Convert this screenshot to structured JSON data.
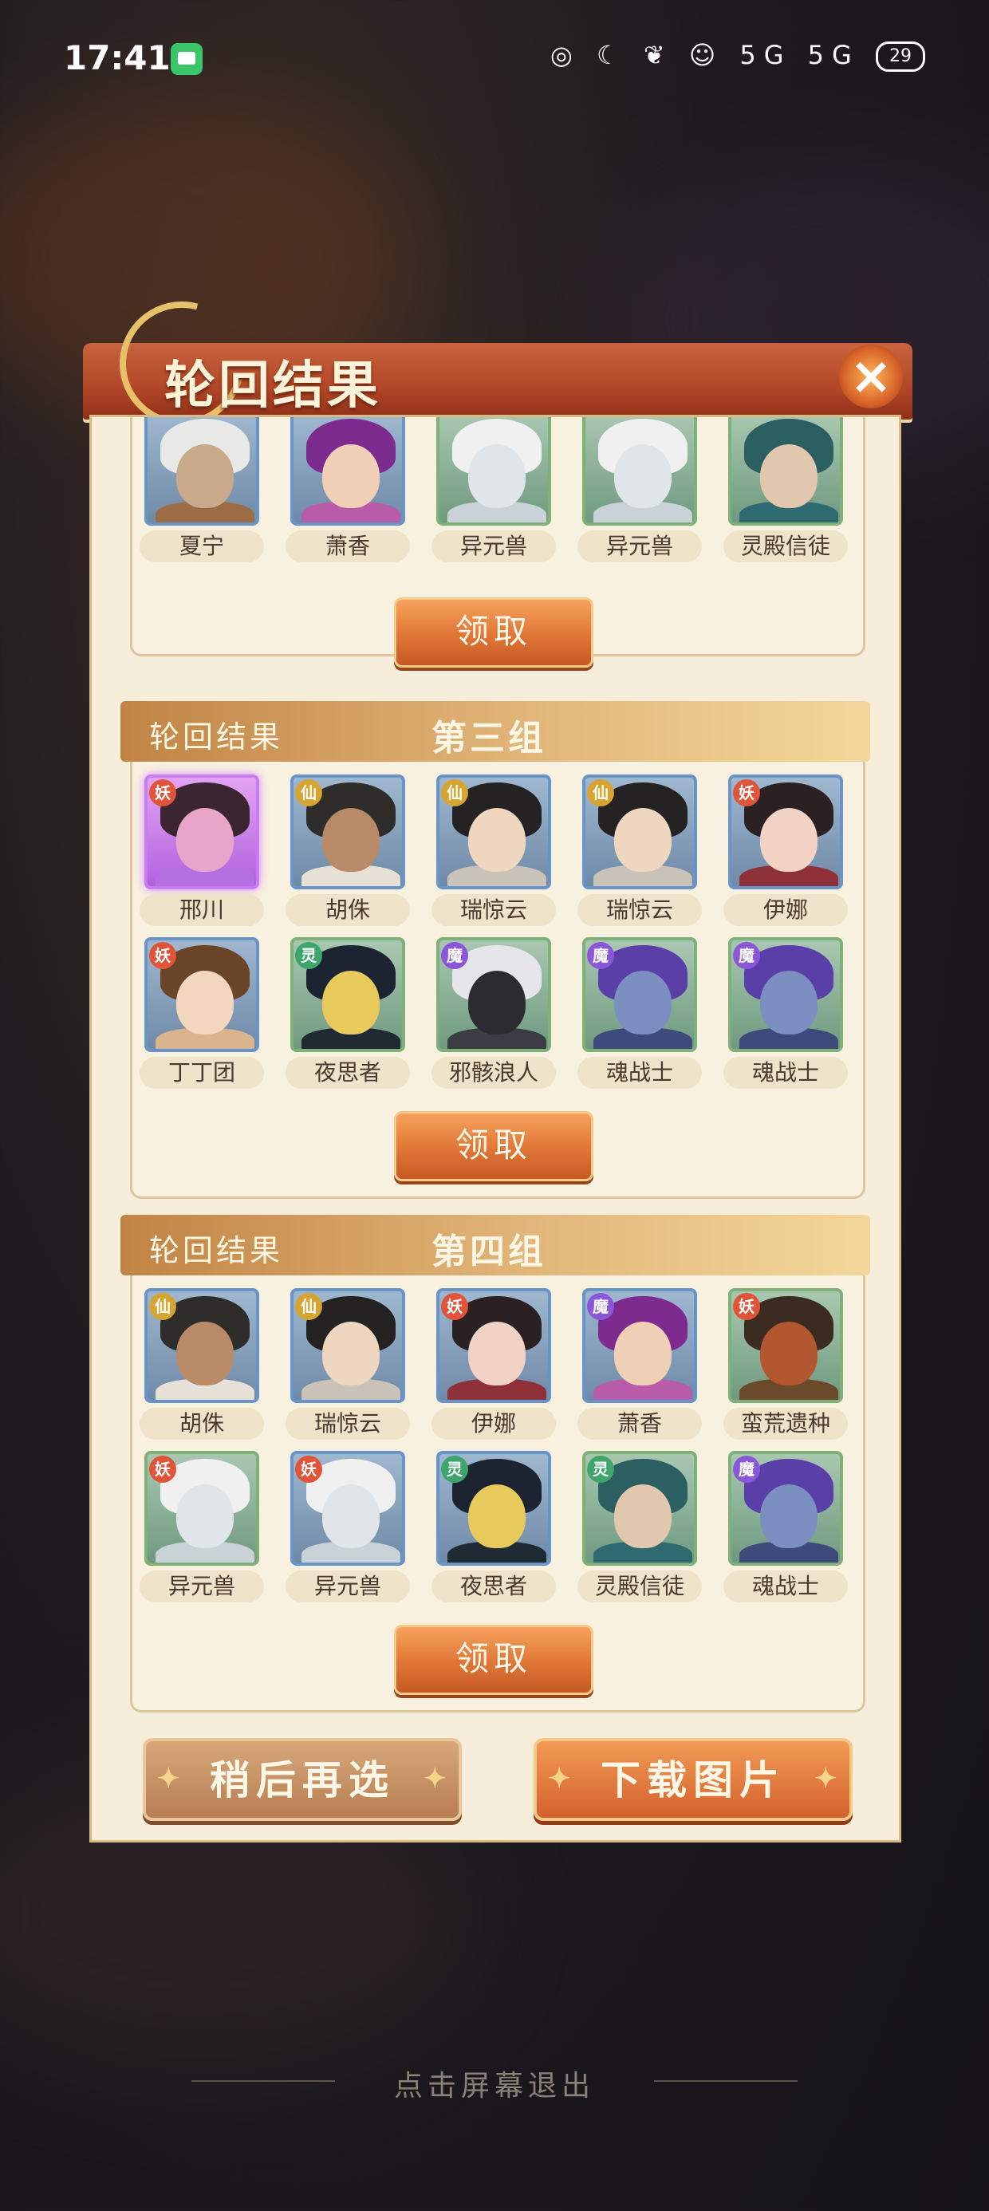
{
  "status_bar": {
    "time": "17:41",
    "network": "5G 5G",
    "battery": "29"
  },
  "dialog": {
    "title": "轮回结果",
    "close_icon": "close-x-icon"
  },
  "groups": [
    {
      "band_left": "",
      "band_right": "",
      "rows": [
        [
          {
            "name": "夏宁",
            "badge": "",
            "frame": "blue",
            "hair": "#e8e8e6",
            "face": "#c8a989",
            "body": "#9c6c45"
          },
          {
            "name": "萧香",
            "badge": "",
            "frame": "blue",
            "hair": "#7d2b8f",
            "face": "#f0cfb7",
            "body": "#b85caa"
          },
          {
            "name": "异元兽",
            "badge": "",
            "frame": "green",
            "hair": "#f0f0f0",
            "face": "#dfe5e9",
            "body": "#c9d2d6"
          },
          {
            "name": "异元兽",
            "badge": "",
            "frame": "green",
            "hair": "#f0f0f0",
            "face": "#dfe5e9",
            "body": "#c9d2d6"
          },
          {
            "name": "灵殿信徒",
            "badge": "",
            "frame": "green",
            "hair": "#2c5f62",
            "face": "#e1c7ad",
            "body": "#2e6a70"
          }
        ]
      ],
      "claim_label": "领取"
    },
    {
      "band_left": "轮回结果",
      "band_right": "第三组",
      "rows": [
        [
          {
            "name": "邢川",
            "badge": "妖",
            "frame": "purple",
            "hair": "#3a2530",
            "face": "#e7a6c9",
            "body": "#b66fe0"
          },
          {
            "name": "胡侏",
            "badge": "仙",
            "frame": "blue",
            "hair": "#2e2d2a",
            "face": "#b98a67",
            "body": "#e6e0d6"
          },
          {
            "name": "瑞惊云",
            "badge": "仙",
            "frame": "blue",
            "hair": "#242222",
            "face": "#efd6bf",
            "body": "#c8c2b8"
          },
          {
            "name": "瑞惊云",
            "badge": "仙",
            "frame": "blue",
            "hair": "#242222",
            "face": "#efd6bf",
            "body": "#c8c2b8"
          },
          {
            "name": "伊娜",
            "badge": "妖",
            "frame": "blue",
            "hair": "#2b2022",
            "face": "#f2d2c4",
            "body": "#8f3138"
          }
        ],
        [
          {
            "name": "丁丁团",
            "badge": "妖",
            "frame": "blue",
            "hair": "#6a4527",
            "face": "#f2d7be",
            "body": "#d9b48c"
          },
          {
            "name": "夜思者",
            "badge": "灵",
            "frame": "green",
            "hair": "#1b2430",
            "face": "#e8c95b",
            "body": "#1f2a33"
          },
          {
            "name": "邪骸浪人",
            "badge": "魔",
            "frame": "green",
            "hair": "#e6e6ea",
            "face": "#2b2b31",
            "body": "#3b3c44"
          },
          {
            "name": "魂战士",
            "badge": "魔",
            "frame": "green",
            "hair": "#5a3fa8",
            "face": "#7b8fc0",
            "body": "#3f4a7c"
          },
          {
            "name": "魂战士",
            "badge": "魔",
            "frame": "green",
            "hair": "#5a3fa8",
            "face": "#7b8fc0",
            "body": "#3f4a7c"
          }
        ]
      ],
      "claim_label": "领取"
    },
    {
      "band_left": "轮回结果",
      "band_right": "第四组",
      "rows": [
        [
          {
            "name": "胡侏",
            "badge": "仙",
            "frame": "blue",
            "hair": "#2e2d2a",
            "face": "#b98a67",
            "body": "#e6e0d6"
          },
          {
            "name": "瑞惊云",
            "badge": "仙",
            "frame": "blue",
            "hair": "#242222",
            "face": "#efd6bf",
            "body": "#c8c2b8"
          },
          {
            "name": "伊娜",
            "badge": "妖",
            "frame": "blue",
            "hair": "#2b2022",
            "face": "#f2d2c4",
            "body": "#8f3138"
          },
          {
            "name": "萧香",
            "badge": "魔",
            "frame": "blue",
            "hair": "#7d2b8f",
            "face": "#f0cfb7",
            "body": "#b85caa"
          },
          {
            "name": "蛮荒遗种",
            "badge": "妖",
            "frame": "green",
            "hair": "#3c2b20",
            "face": "#b2572f",
            "body": "#6b4a2c"
          }
        ],
        [
          {
            "name": "异元兽",
            "badge": "妖",
            "frame": "green",
            "hair": "#f0f0f0",
            "face": "#dfe5e9",
            "body": "#c9d2d6"
          },
          {
            "name": "异元兽",
            "badge": "妖",
            "frame": "blue",
            "hair": "#f0f0f0",
            "face": "#dfe5e9",
            "body": "#c9d2d6"
          },
          {
            "name": "夜思者",
            "badge": "灵",
            "frame": "blue",
            "hair": "#1b2430",
            "face": "#e8c95b",
            "body": "#1f2a33"
          },
          {
            "name": "灵殿信徒",
            "badge": "灵",
            "frame": "green",
            "hair": "#2c5f62",
            "face": "#e1c7ad",
            "body": "#2e6a70"
          },
          {
            "name": "魂战士",
            "badge": "魔",
            "frame": "green",
            "hair": "#5a3fa8",
            "face": "#7b8fc0",
            "body": "#3f4a7c"
          }
        ]
      ],
      "claim_label": "领取"
    }
  ],
  "badge_colors": {
    "妖": "#e0553a",
    "仙": "#d6a531",
    "灵": "#3fa66b",
    "魔": "#8a57d8"
  },
  "footer": {
    "later_label": "稍后再选",
    "download_label": "下载图片",
    "exit_hint": "点击屏幕退出"
  }
}
